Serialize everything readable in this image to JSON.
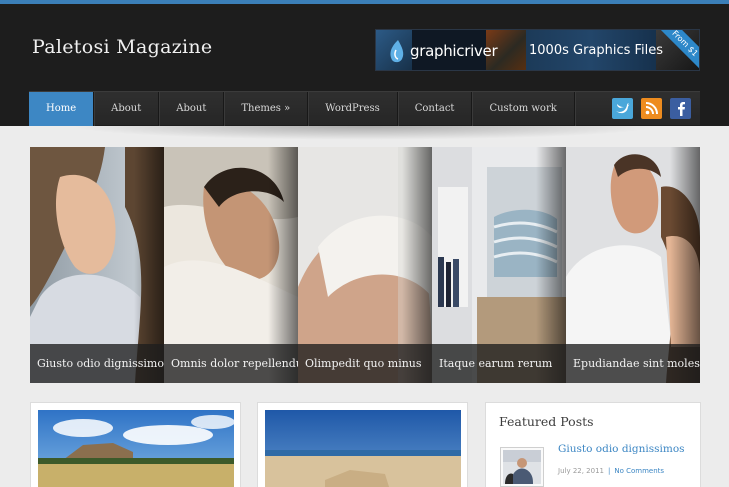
{
  "site": {
    "title": "Paletosi Magazine"
  },
  "banner": {
    "brand": "graphicriver",
    "tagline": "1000s Graphics Files",
    "badge": "From $1"
  },
  "nav": {
    "items": [
      {
        "label": "Home",
        "active": true
      },
      {
        "label": "About"
      },
      {
        "label": "About"
      },
      {
        "label": "Themes »"
      },
      {
        "label": "WordPress"
      },
      {
        "label": "Contact"
      },
      {
        "label": "Custom work"
      }
    ],
    "social": [
      {
        "icon": "twitter-icon",
        "color": "#4aa7da"
      },
      {
        "icon": "rss-icon",
        "color": "#ee8c1f"
      },
      {
        "icon": "facebook-icon",
        "color": "#3b5ea0"
      }
    ]
  },
  "slider": {
    "captions": [
      "Giusto odio dignissimos",
      "Omnis dolor repellendus",
      "Olimpedit quo minus",
      "Itaque earum rerum",
      "Epudiandae sint molestiae"
    ]
  },
  "featured": {
    "heading": "Featured Posts",
    "post_title": "Giusto odio dignissimos",
    "post_date": "July 22, 2011",
    "post_comments": "No Comments"
  },
  "colors": {
    "accent": "#3d87c4",
    "header_bg": "#1d1d1d",
    "page_bg": "#ececec"
  }
}
